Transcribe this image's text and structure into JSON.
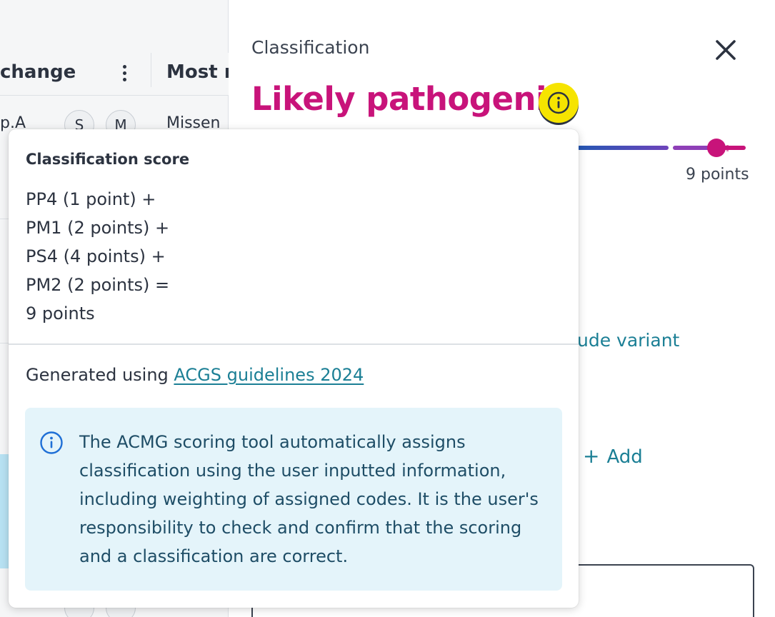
{
  "table": {
    "header_change": "change",
    "header_most": "Most r",
    "row1_variant": "p.A",
    "row1_chip_s": "S",
    "row1_chip_m": "M",
    "row1_consequence": "Missen"
  },
  "panel": {
    "kicker": "Classification",
    "title": "Likely pathogenic",
    "points_label": "9 points",
    "exclude_link": "ude variant",
    "add_plus": "+",
    "add_label": "Add"
  },
  "popover": {
    "heading": "Classification score",
    "lines": [
      "PP4 (1 point) +",
      "PM1 (2 points) +",
      "PS4 (4 points) +",
      "PM2 (2 points) =",
      "9 points"
    ],
    "generated_prefix": "Generated using ",
    "guidelines_link": "ACGS guidelines 2024",
    "notice_text": "The ACMG scoring tool automatically assigns classification using the user inputted information, including weighting of assigned codes. It is the user's responsibility to check and confirm that the scoring and a classification are correct."
  },
  "colors": {
    "title_magenta": "#c8137a",
    "badge_yellow": "#f6e400",
    "link_teal": "#1b7f95",
    "notice_bg": "#e4f4fa"
  }
}
